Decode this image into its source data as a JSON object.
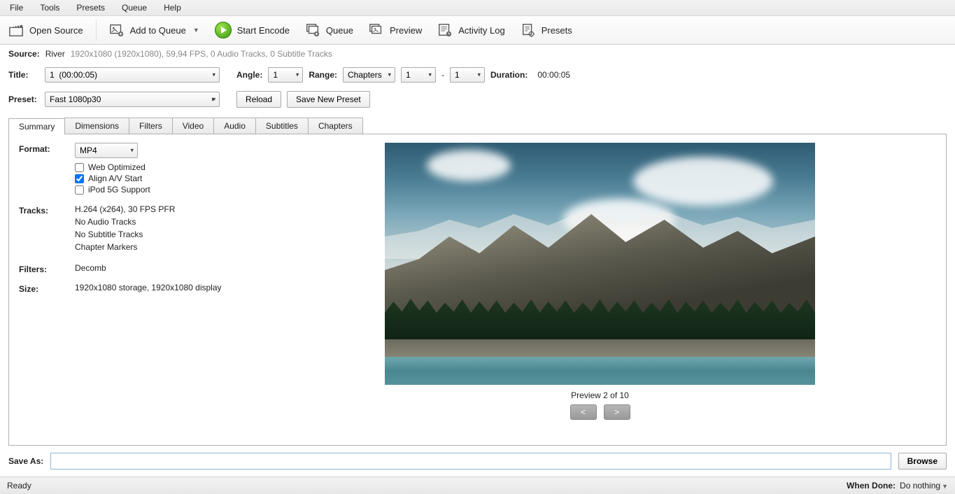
{
  "menu": {
    "items": [
      "File",
      "Tools",
      "Presets",
      "Queue",
      "Help"
    ]
  },
  "toolbar": {
    "open_source": "Open Source",
    "add_to_queue": "Add to Queue",
    "start_encode": "Start Encode",
    "queue": "Queue",
    "preview": "Preview",
    "activity_log": "Activity Log",
    "presets": "Presets"
  },
  "source": {
    "label": "Source:",
    "name": "River",
    "details": "1920x1080 (1920x1080), 59,94 FPS, 0 Audio Tracks, 0 Subtitle Tracks"
  },
  "title": {
    "label": "Title:",
    "value": "1  (00:00:05)"
  },
  "angle": {
    "label": "Angle:",
    "value": "1"
  },
  "range": {
    "label": "Range:",
    "type": "Chapters",
    "from": "1",
    "dash": "-",
    "to": "1"
  },
  "duration": {
    "label": "Duration:",
    "value": "00:00:05"
  },
  "preset": {
    "label": "Preset:",
    "value": "Fast 1080p30",
    "reload": "Reload",
    "save_new": "Save New Preset"
  },
  "tabs": [
    "Summary",
    "Dimensions",
    "Filters",
    "Video",
    "Audio",
    "Subtitles",
    "Chapters"
  ],
  "summary": {
    "format_label": "Format:",
    "format_value": "MP4",
    "web_optimized": "Web Optimized",
    "align_av": "Align A/V Start",
    "ipod": "iPod 5G Support",
    "tracks_label": "Tracks:",
    "tracks_lines": [
      "H.264 (x264), 30 FPS PFR",
      "No Audio Tracks",
      "No Subtitle Tracks",
      "Chapter Markers"
    ],
    "filters_label": "Filters:",
    "filters_value": "Decomb",
    "size_label": "Size:",
    "size_value": "1920x1080 storage, 1920x1080 display"
  },
  "preview": {
    "info": "Preview 2 of 10",
    "prev": "<",
    "next": ">"
  },
  "save": {
    "label": "Save As:",
    "value": "",
    "browse": "Browse"
  },
  "status": {
    "ready": "Ready",
    "when_done_label": "When Done:",
    "when_done_value": "Do nothing"
  }
}
